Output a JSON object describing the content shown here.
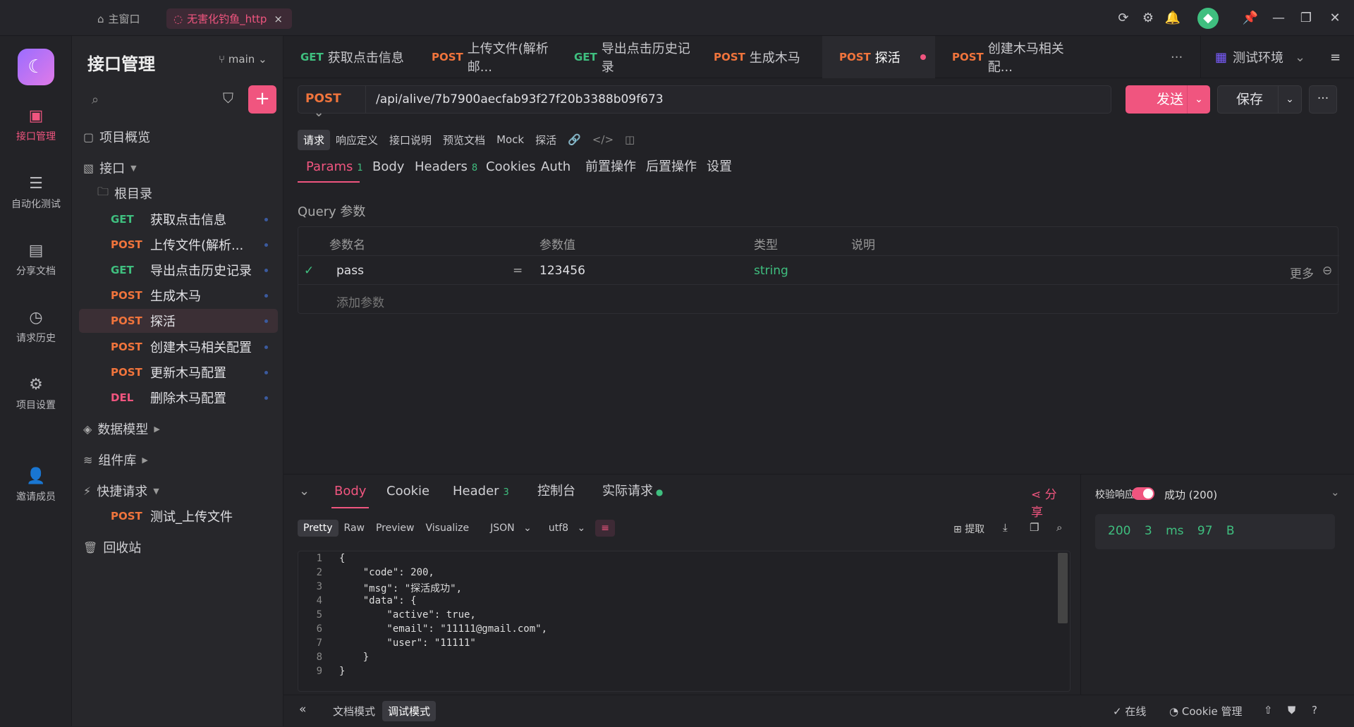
{
  "titlebar": {
    "home_label": "主窗口",
    "project_tab": "无害化钓鱼_http",
    "close": "×"
  },
  "leftnav": [
    {
      "label": "接口管理",
      "icon": "api-icon",
      "active": true
    },
    {
      "label": "自动化测试",
      "icon": "automation-icon"
    },
    {
      "label": "分享文档",
      "icon": "share-doc-icon"
    },
    {
      "label": "请求历史",
      "icon": "history-icon"
    },
    {
      "label": "项目设置",
      "icon": "settings-icon"
    },
    {
      "label": "邀请成员",
      "icon": "invite-icon"
    }
  ],
  "sidebar": {
    "title": "接口管理",
    "branch": "main",
    "overview": "项目概览",
    "apis_folder": "接口",
    "root": "根目录",
    "items": [
      {
        "method": "GET",
        "name": "获取点击信息"
      },
      {
        "method": "POST",
        "name": "上传文件(解析..."
      },
      {
        "method": "GET",
        "name": "导出点击历史记录"
      },
      {
        "method": "POST",
        "name": "生成木马"
      },
      {
        "method": "POST",
        "name": "探活"
      },
      {
        "method": "POST",
        "name": "创建木马相关配置"
      },
      {
        "method": "POST",
        "name": "更新木马配置"
      },
      {
        "method": "DEL",
        "name": "删除木马配置"
      }
    ],
    "data_model": "数据模型",
    "components": "组件库",
    "quick": "快捷请求",
    "quick_item": {
      "method": "POST",
      "name": "测试_上传文件"
    },
    "trash": "回收站"
  },
  "tabs": [
    {
      "method": "GET",
      "name": "获取点击信息"
    },
    {
      "method": "POST",
      "name": "上传文件(解析邮..."
    },
    {
      "method": "GET",
      "name": "导出点击历史记录"
    },
    {
      "method": "POST",
      "name": "生成木马"
    },
    {
      "method": "POST",
      "name": "探活"
    },
    {
      "method": "POST",
      "name": "创建木马相关配..."
    }
  ],
  "env": "测试环境",
  "request": {
    "method": "POST",
    "url": "/api/alive/7b7900aecfab93f27f20b3388b09f673",
    "send": "发送",
    "save": "保存"
  },
  "subtabs": [
    "请求",
    "响应定义",
    "接口说明",
    "预览文档",
    "Mock",
    "探活"
  ],
  "param_tabs": [
    {
      "label": "Params",
      "count": "1"
    },
    {
      "label": "Body",
      "count": ""
    },
    {
      "label": "Headers",
      "count": "8"
    },
    {
      "label": "Cookies",
      "count": ""
    },
    {
      "label": "Auth",
      "count": ""
    },
    {
      "label": "前置操作",
      "count": ""
    },
    {
      "label": "后置操作",
      "count": ""
    },
    {
      "label": "设置",
      "count": ""
    }
  ],
  "query_label": "Query 参数",
  "param_table": {
    "headers": [
      "参数名",
      "参数值",
      "类型",
      "说明"
    ],
    "row": {
      "name": "pass",
      "eq": "=",
      "value": "123456",
      "type": "string",
      "more": "更多"
    },
    "add": "添加参数"
  },
  "response": {
    "tabs": [
      {
        "label": "Body",
        "count": ""
      },
      {
        "label": "Cookie",
        "count": ""
      },
      {
        "label": "Header",
        "count": "3"
      },
      {
        "label": "控制台",
        "count": ""
      },
      {
        "label": "实际请求",
        "count": ""
      }
    ],
    "share": "分享",
    "formats": [
      "Pretty",
      "Raw",
      "Preview",
      "Visualize"
    ],
    "lang": "JSON",
    "encoding": "utf8",
    "extract": "提取",
    "lines": [
      "{",
      "    \"code\": 200,",
      "    \"msg\": \"探活成功\",",
      "    \"data\": {",
      "        \"active\": true,",
      "        \"email\": \"11111@gmail.com\",",
      "        \"user\": \"11111\"",
      "    }",
      "}"
    ],
    "validate_label": "校验响应",
    "status_label": "成功 (200)",
    "stats": "200 3 ms 97 B"
  },
  "bottombar": {
    "doc_mode": "文档模式",
    "debug_mode": "调试模式",
    "online": "在线",
    "cookie_mgmt": "Cookie 管理"
  }
}
